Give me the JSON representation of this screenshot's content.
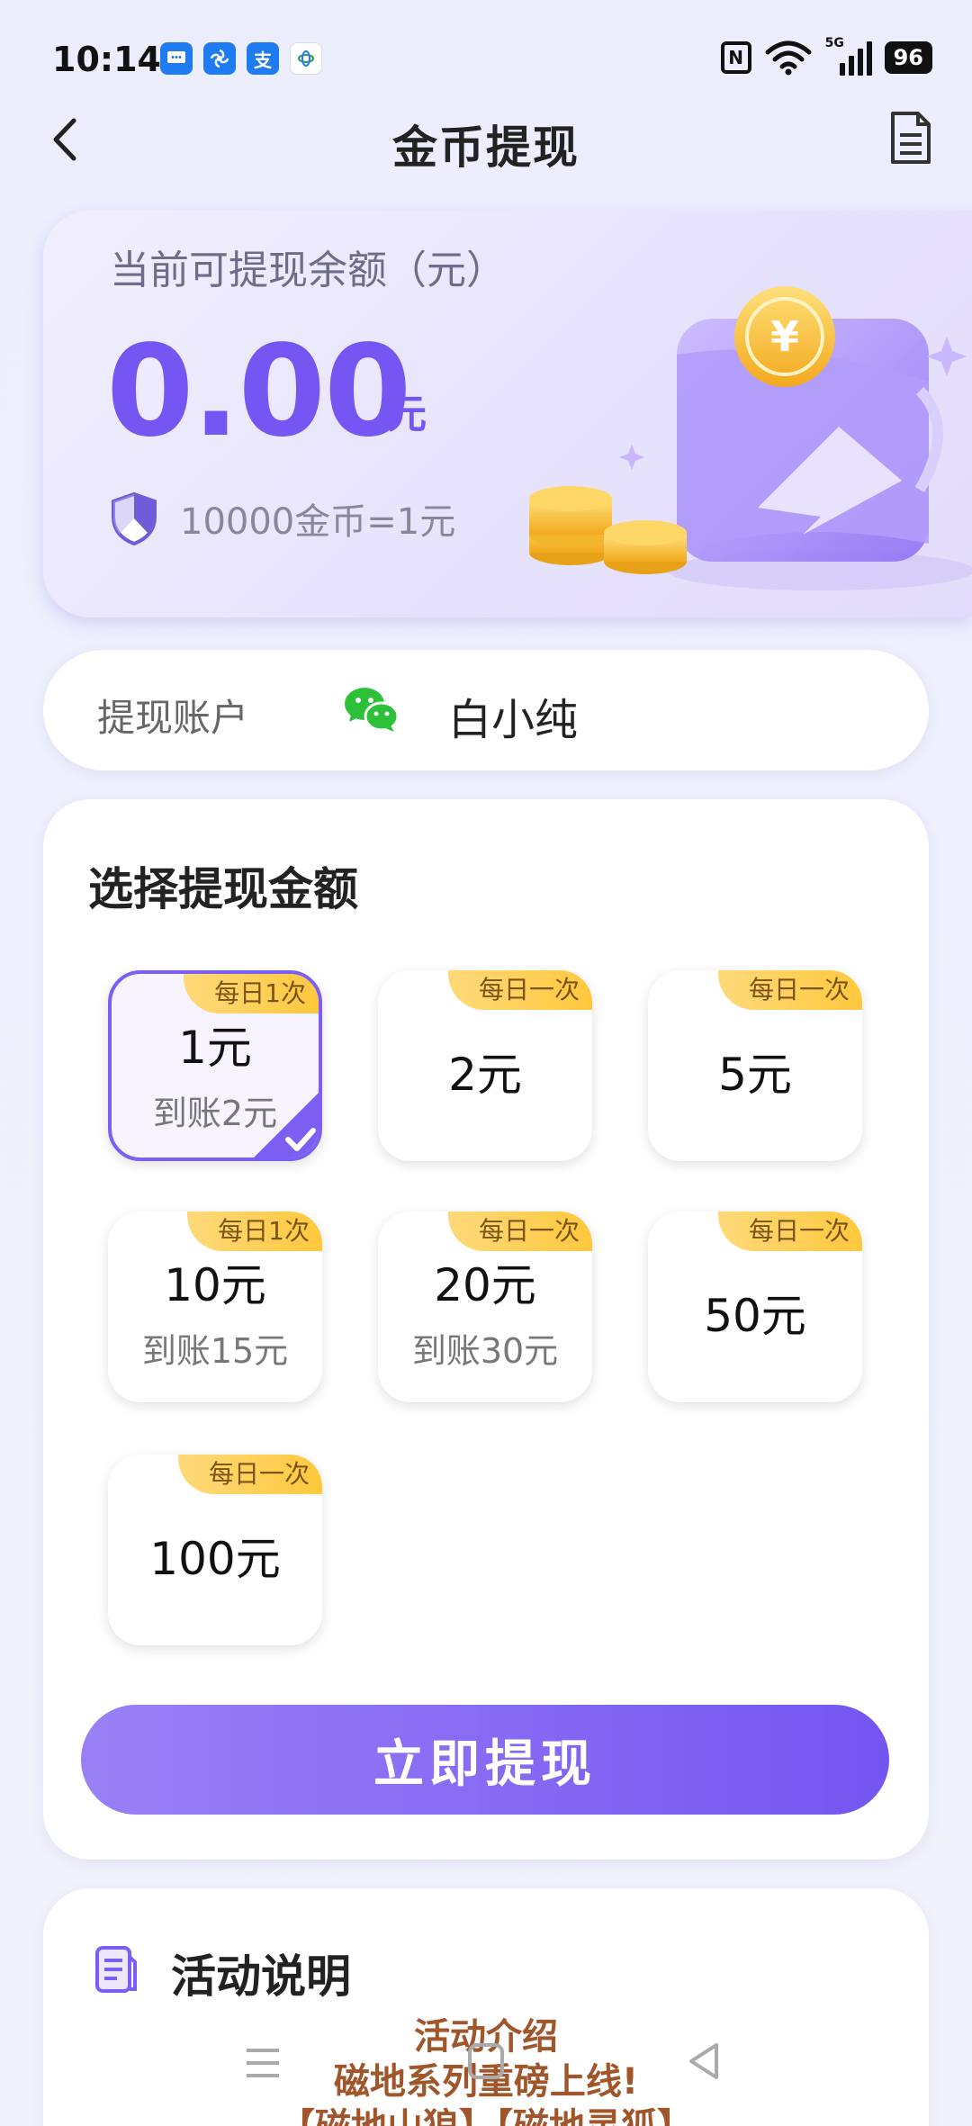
{
  "status_bar": {
    "time": "10:14",
    "notification_icons": [
      "message-icon",
      "fan-icon",
      "alipay-icon",
      "mobile-icon"
    ],
    "alipay_glyph": "支",
    "nfc_glyph": "N",
    "network": "5G",
    "battery": "96"
  },
  "header": {
    "title": "金币提现"
  },
  "balance": {
    "label": "当前可提现余额（元）",
    "value": "0.00",
    "unit": "元",
    "rate": "10000金币=1元",
    "coin_symbol": "¥"
  },
  "account": {
    "label": "提现账户",
    "name": "白小纯"
  },
  "amounts": {
    "title": "选择提现金额",
    "options": [
      {
        "tag": "每日1次",
        "amount": "1元",
        "bonus": "到账2元",
        "selected": true
      },
      {
        "tag": "每日一次",
        "amount": "2元",
        "bonus": ""
      },
      {
        "tag": "每日一次",
        "amount": "5元",
        "bonus": ""
      },
      {
        "tag": "每日1次",
        "amount": "10元",
        "bonus": "到账15元"
      },
      {
        "tag": "每日一次",
        "amount": "20元",
        "bonus": "到账30元"
      },
      {
        "tag": "每日一次",
        "amount": "50元",
        "bonus": ""
      },
      {
        "tag": "每日一次",
        "amount": "100元",
        "bonus": ""
      }
    ],
    "button_label": "立即提现"
  },
  "activity": {
    "title": "活动说明",
    "line1": "活动介绍",
    "line2": "磁地系列重磅上线!",
    "line3": "【磁地山狼】【磁地灵狐】"
  },
  "colors": {
    "accent": "#7556f3",
    "tag": "#ffc83d",
    "promo": "#a0562a"
  }
}
